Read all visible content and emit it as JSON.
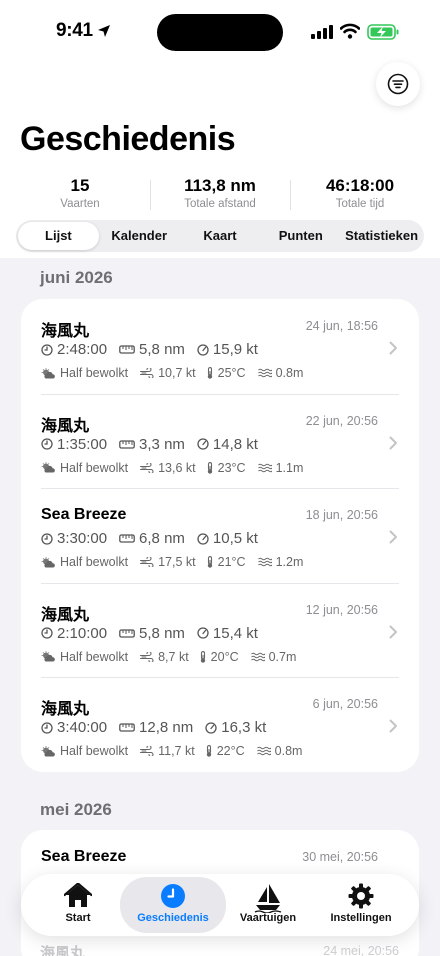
{
  "status": {
    "time": "9:41"
  },
  "header": {
    "title": "Geschiedenis"
  },
  "stats": [
    {
      "value": "15",
      "label": "Vaarten"
    },
    {
      "value": "113,8 nm",
      "label": "Totale afstand"
    },
    {
      "value": "46:18:00",
      "label": "Totale tijd"
    }
  ],
  "segments": [
    "Lijst",
    "Kalender",
    "Kaart",
    "Punten",
    "Statistieken"
  ],
  "sections": [
    {
      "month": "juni 2026",
      "trips": [
        {
          "name": "海風丸",
          "date": "24 jun, 18:56",
          "duration": "2:48:00",
          "distance": "5,8 nm",
          "speed": "15,9 kt",
          "weather": "Half bewolkt",
          "wind": "10,7 kt",
          "temp": "25°C",
          "waves": "0.8m"
        },
        {
          "name": "海風丸",
          "date": "22 jun, 20:56",
          "duration": "1:35:00",
          "distance": "3,3 nm",
          "speed": "14,8 kt",
          "weather": "Half bewolkt",
          "wind": "13,6 kt",
          "temp": "23°C",
          "waves": "1.1m"
        },
        {
          "name": "Sea Breeze",
          "date": "18 jun, 20:56",
          "duration": "3:30:00",
          "distance": "6,8 nm",
          "speed": "10,5 kt",
          "weather": "Half bewolkt",
          "wind": "17,5 kt",
          "temp": "21°C",
          "waves": "1.2m"
        },
        {
          "name": "海風丸",
          "date": "12 jun, 20:56",
          "duration": "2:10:00",
          "distance": "5,8 nm",
          "speed": "15,4 kt",
          "weather": "Half bewolkt",
          "wind": "8,7 kt",
          "temp": "20°C",
          "waves": "0.7m"
        },
        {
          "name": "海風丸",
          "date": "6 jun, 20:56",
          "duration": "3:40:00",
          "distance": "12,8 nm",
          "speed": "16,3 kt",
          "weather": "Half bewolkt",
          "wind": "11,7 kt",
          "temp": "22°C",
          "waves": "0.8m"
        }
      ]
    },
    {
      "month": "mei 2026",
      "trips": [
        {
          "name": "Sea Breeze",
          "date": "30 mei, 20:56"
        },
        {
          "name": "海風丸",
          "date": "24 mei, 20:56"
        }
      ]
    }
  ],
  "tabs": [
    "Start",
    "Geschiedenis",
    "Vaartuigen",
    "Instellingen"
  ],
  "colors": {
    "accent": "#0a7cff",
    "background": "#f2f2f7",
    "card": "#ffffff",
    "secondary_text": "#8e8e93"
  },
  "icons": [
    "location-arrow-icon",
    "cellular-signal-icon",
    "wifi-icon",
    "battery-charging-icon",
    "filter-icon",
    "clock-icon",
    "ruler-icon",
    "speedometer-icon",
    "partly-cloudy-icon",
    "wind-icon",
    "thermometer-icon",
    "waves-icon",
    "chevron-right-icon",
    "house-icon",
    "history-clock-icon",
    "sailboat-icon",
    "gear-icon"
  ]
}
